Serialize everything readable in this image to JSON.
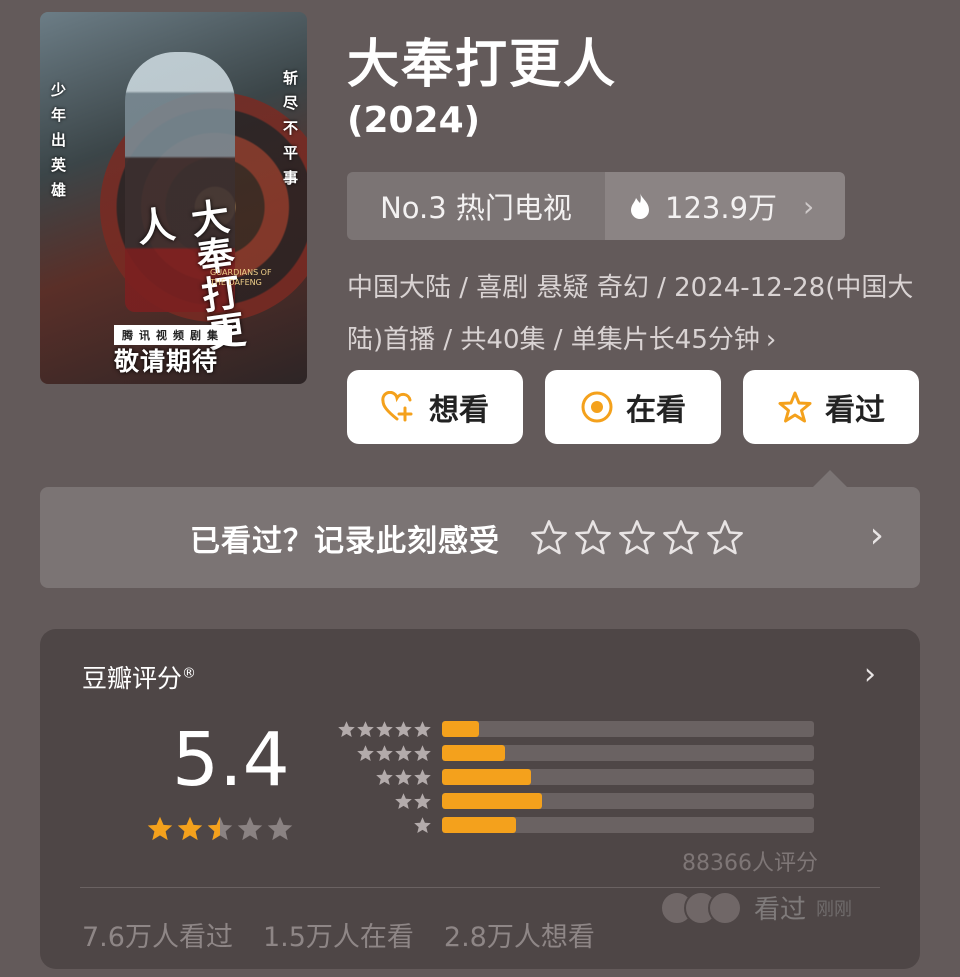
{
  "poster": {
    "left_text": "少年出英雄",
    "right_text": "斩尽不平事",
    "calligraphy": "大奉打更人",
    "english": "GUARDIANS OF THE DAFENG",
    "label": "腾讯视频剧集",
    "coming": "敬请期待"
  },
  "title": "大奉打更人",
  "year": "(2024)",
  "rank": {
    "label": "No.3 热门电视",
    "heat": "123.9万"
  },
  "meta": "中国大陆 / 喜剧 悬疑 奇幻 / 2024-12-28(中国大陆)首播 / 共40集 / 单集片长45分钟",
  "actions": [
    {
      "label": "想看",
      "icon": "heart-plus-icon"
    },
    {
      "label": "在看",
      "icon": "target-icon"
    },
    {
      "label": "看过",
      "icon": "star-outline-icon"
    }
  ],
  "record": {
    "text": "已看过？记录此刻感受",
    "stars": 5
  },
  "rating": {
    "header": "豆瓣评分",
    "header_mark": "®",
    "score": "5.4",
    "score_stars": 2.5,
    "distribution": [
      {
        "stars": 5,
        "fraction": 0.1
      },
      {
        "stars": 4,
        "fraction": 0.17
      },
      {
        "stars": 3,
        "fraction": 0.24
      },
      {
        "stars": 2,
        "fraction": 0.27
      },
      {
        "stars": 1,
        "fraction": 0.2
      }
    ],
    "count": "88366人评分",
    "faded_watched": "看过",
    "faded_time": "刚刚"
  },
  "stats": [
    "7.6万人看过",
    "1.5万人在看",
    "2.8万人想看"
  ],
  "colors": {
    "accent": "#f4a11c",
    "background": "#635a5a",
    "card": "#4e4646"
  }
}
